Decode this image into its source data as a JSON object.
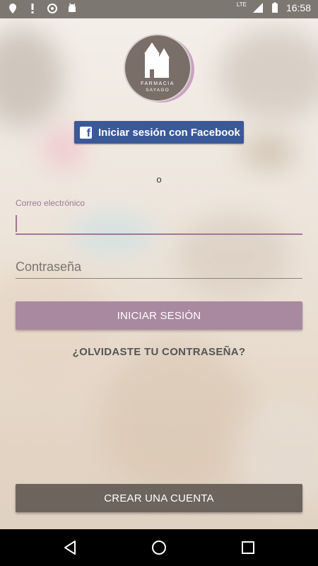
{
  "status_bar": {
    "time": "16:58",
    "network": "LTE",
    "icons": [
      "location-icon",
      "alert-icon",
      "sync-icon",
      "android-icon",
      "signal-icon",
      "battery-icon"
    ]
  },
  "logo": {
    "brand_top": "FARMACIA",
    "brand_bottom": "SAYAGO"
  },
  "facebook_button": {
    "label": "Iniciar sesión con Facebook",
    "icon": "facebook-icon",
    "color": "#3b5998"
  },
  "separator": {
    "text": "o"
  },
  "email": {
    "label": "Correo electrónico",
    "value": ""
  },
  "password": {
    "placeholder": "Contraseña",
    "value": ""
  },
  "login_button": {
    "label": "INICIAR SESIÓN",
    "color": "#a8899f"
  },
  "forgot_link": {
    "label": "¿OLVIDASTE TU CONTRASEÑA?"
  },
  "create_button": {
    "label": "CREAR UNA CUENTA",
    "color": "#6d645e"
  },
  "nav_bar": {
    "icons": [
      "back-icon",
      "home-icon",
      "recents-icon"
    ]
  }
}
